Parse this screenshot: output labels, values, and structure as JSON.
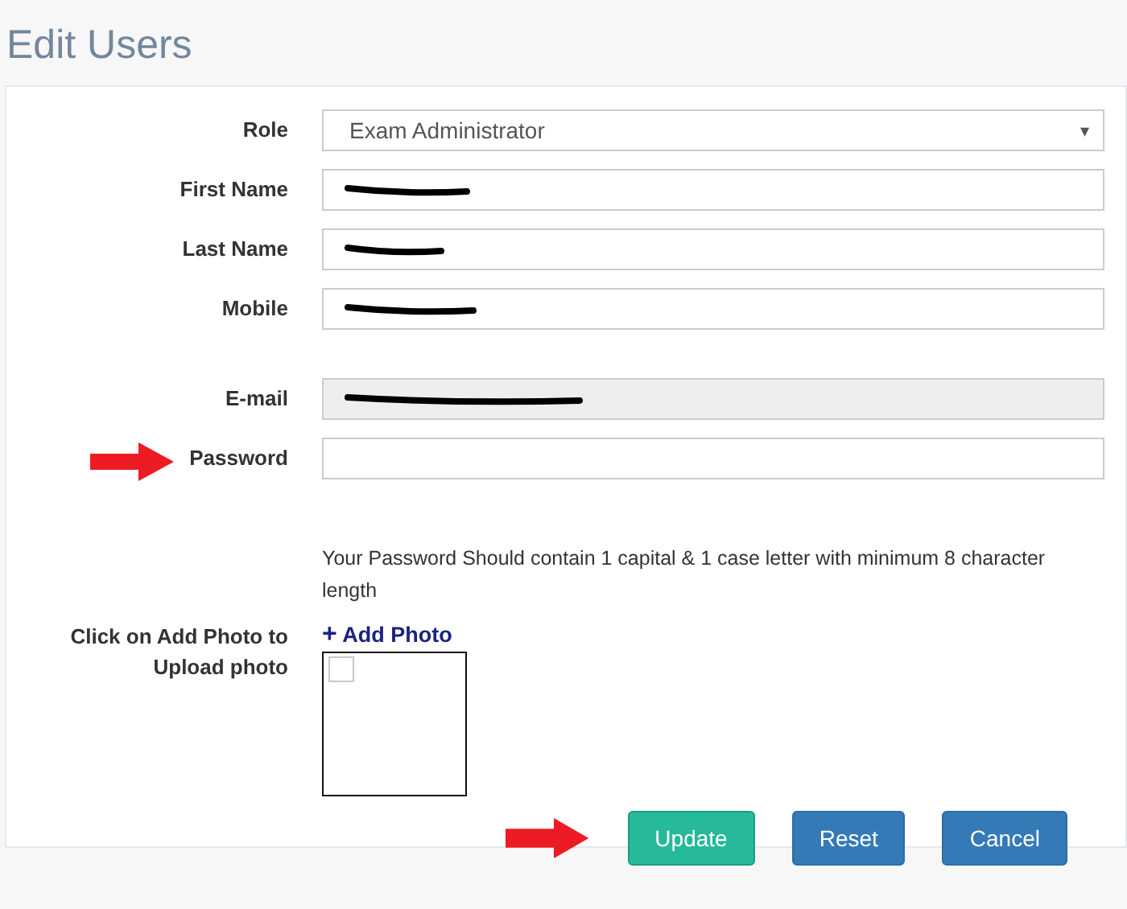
{
  "title": "Edit Users",
  "fields": [
    {
      "label": "Role",
      "kind": "select",
      "value": "Exam Administrator",
      "caret": "▾"
    },
    {
      "label": "First Name",
      "kind": "text",
      "redacted": true,
      "disabled": false
    },
    {
      "label": "Last Name",
      "kind": "text",
      "redacted": true,
      "disabled": false
    },
    {
      "label": "Mobile",
      "kind": "text",
      "redacted": true,
      "disabled": false
    },
    {
      "label": "E-mail",
      "kind": "text",
      "redacted": true,
      "disabled": true,
      "spaced": true
    },
    {
      "label": "Password",
      "kind": "text",
      "annotated": true,
      "disabled": false
    }
  ],
  "hint": "Your Password Should contain 1 capital & 1 case letter with minimum 8 character length",
  "photo": {
    "label": "Click on Add Photo to Upload photo",
    "plus": "+",
    "link": "Add Photo"
  },
  "buttons": [
    {
      "label": "Update",
      "kind": "primary"
    },
    {
      "label": "Reset",
      "kind": "secondary"
    },
    {
      "label": "Cancel",
      "kind": "secondary"
    }
  ],
  "buttons_annotated": true
}
